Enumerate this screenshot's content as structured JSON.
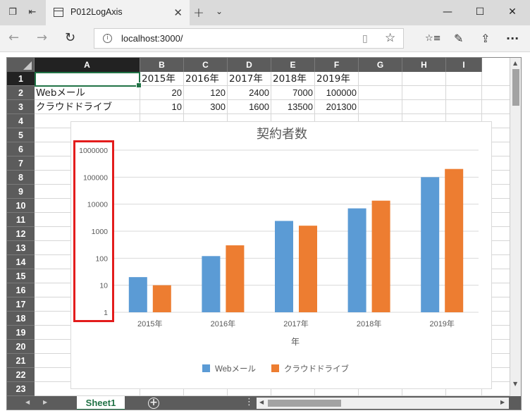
{
  "browser": {
    "tab_title": "P012LogAxis",
    "url": "localhost:3000/",
    "close_glyph": "✕",
    "new_tab_glyph": "+",
    "tab_menu_glyph": "⌄",
    "minimize_glyph": "—",
    "maximize_glyph": "☐",
    "window_close_glyph": "✕",
    "back_glyph": "←",
    "forward_glyph": "→",
    "refresh_glyph": "↻",
    "info_glyph": "i",
    "reader_glyph": "▯",
    "favorite_glyph": "☆",
    "favorites_list_glyph": "☆≡",
    "pen_glyph": "✎",
    "share_glyph": "⇪",
    "more_glyph": "···"
  },
  "sheet": {
    "columns": [
      "A",
      "B",
      "C",
      "D",
      "E",
      "F",
      "G",
      "H",
      "I"
    ],
    "rows": [
      "1",
      "2",
      "3",
      "4",
      "5",
      "6",
      "7",
      "8",
      "9",
      "10",
      "11",
      "12",
      "13",
      "14",
      "15",
      "16",
      "17",
      "18",
      "19",
      "20",
      "21",
      "22",
      "23"
    ],
    "cells": {
      "B1": "2015年",
      "C1": "2016年",
      "D1": "2017年",
      "E1": "2018年",
      "F1": "2019年",
      "A2": "Webメール",
      "B2": "20",
      "C2": "120",
      "D2": "2400",
      "E2": "7000",
      "F2": "100000",
      "A3": "クラウドドライブ",
      "B3": "10",
      "C3": "300",
      "D3": "1600",
      "E3": "13500",
      "F3": "201300"
    },
    "tab_name": "Sheet1",
    "add_sheet_glyph": "+",
    "options_glyph": "⋮"
  },
  "chart_data": {
    "type": "bar",
    "title": "契約者数",
    "xlabel": "年",
    "ylabel": "",
    "yscale": "log",
    "ylim": [
      1,
      1000000
    ],
    "yticks": [
      "1",
      "10",
      "100",
      "1000",
      "10000",
      "100000",
      "1000000"
    ],
    "categories": [
      "2015年",
      "2016年",
      "2017年",
      "2018年",
      "2019年"
    ],
    "series": [
      {
        "name": "Webメール",
        "values": [
          20,
          120,
          2400,
          7000,
          100000
        ],
        "color": "#5b9bd5"
      },
      {
        "name": "クラウドドライブ",
        "values": [
          10,
          300,
          1600,
          13500,
          201300
        ],
        "color": "#ed7d31"
      }
    ],
    "legend": "bottom",
    "grid": true
  },
  "annotation": {
    "color": "#e31c1c"
  }
}
